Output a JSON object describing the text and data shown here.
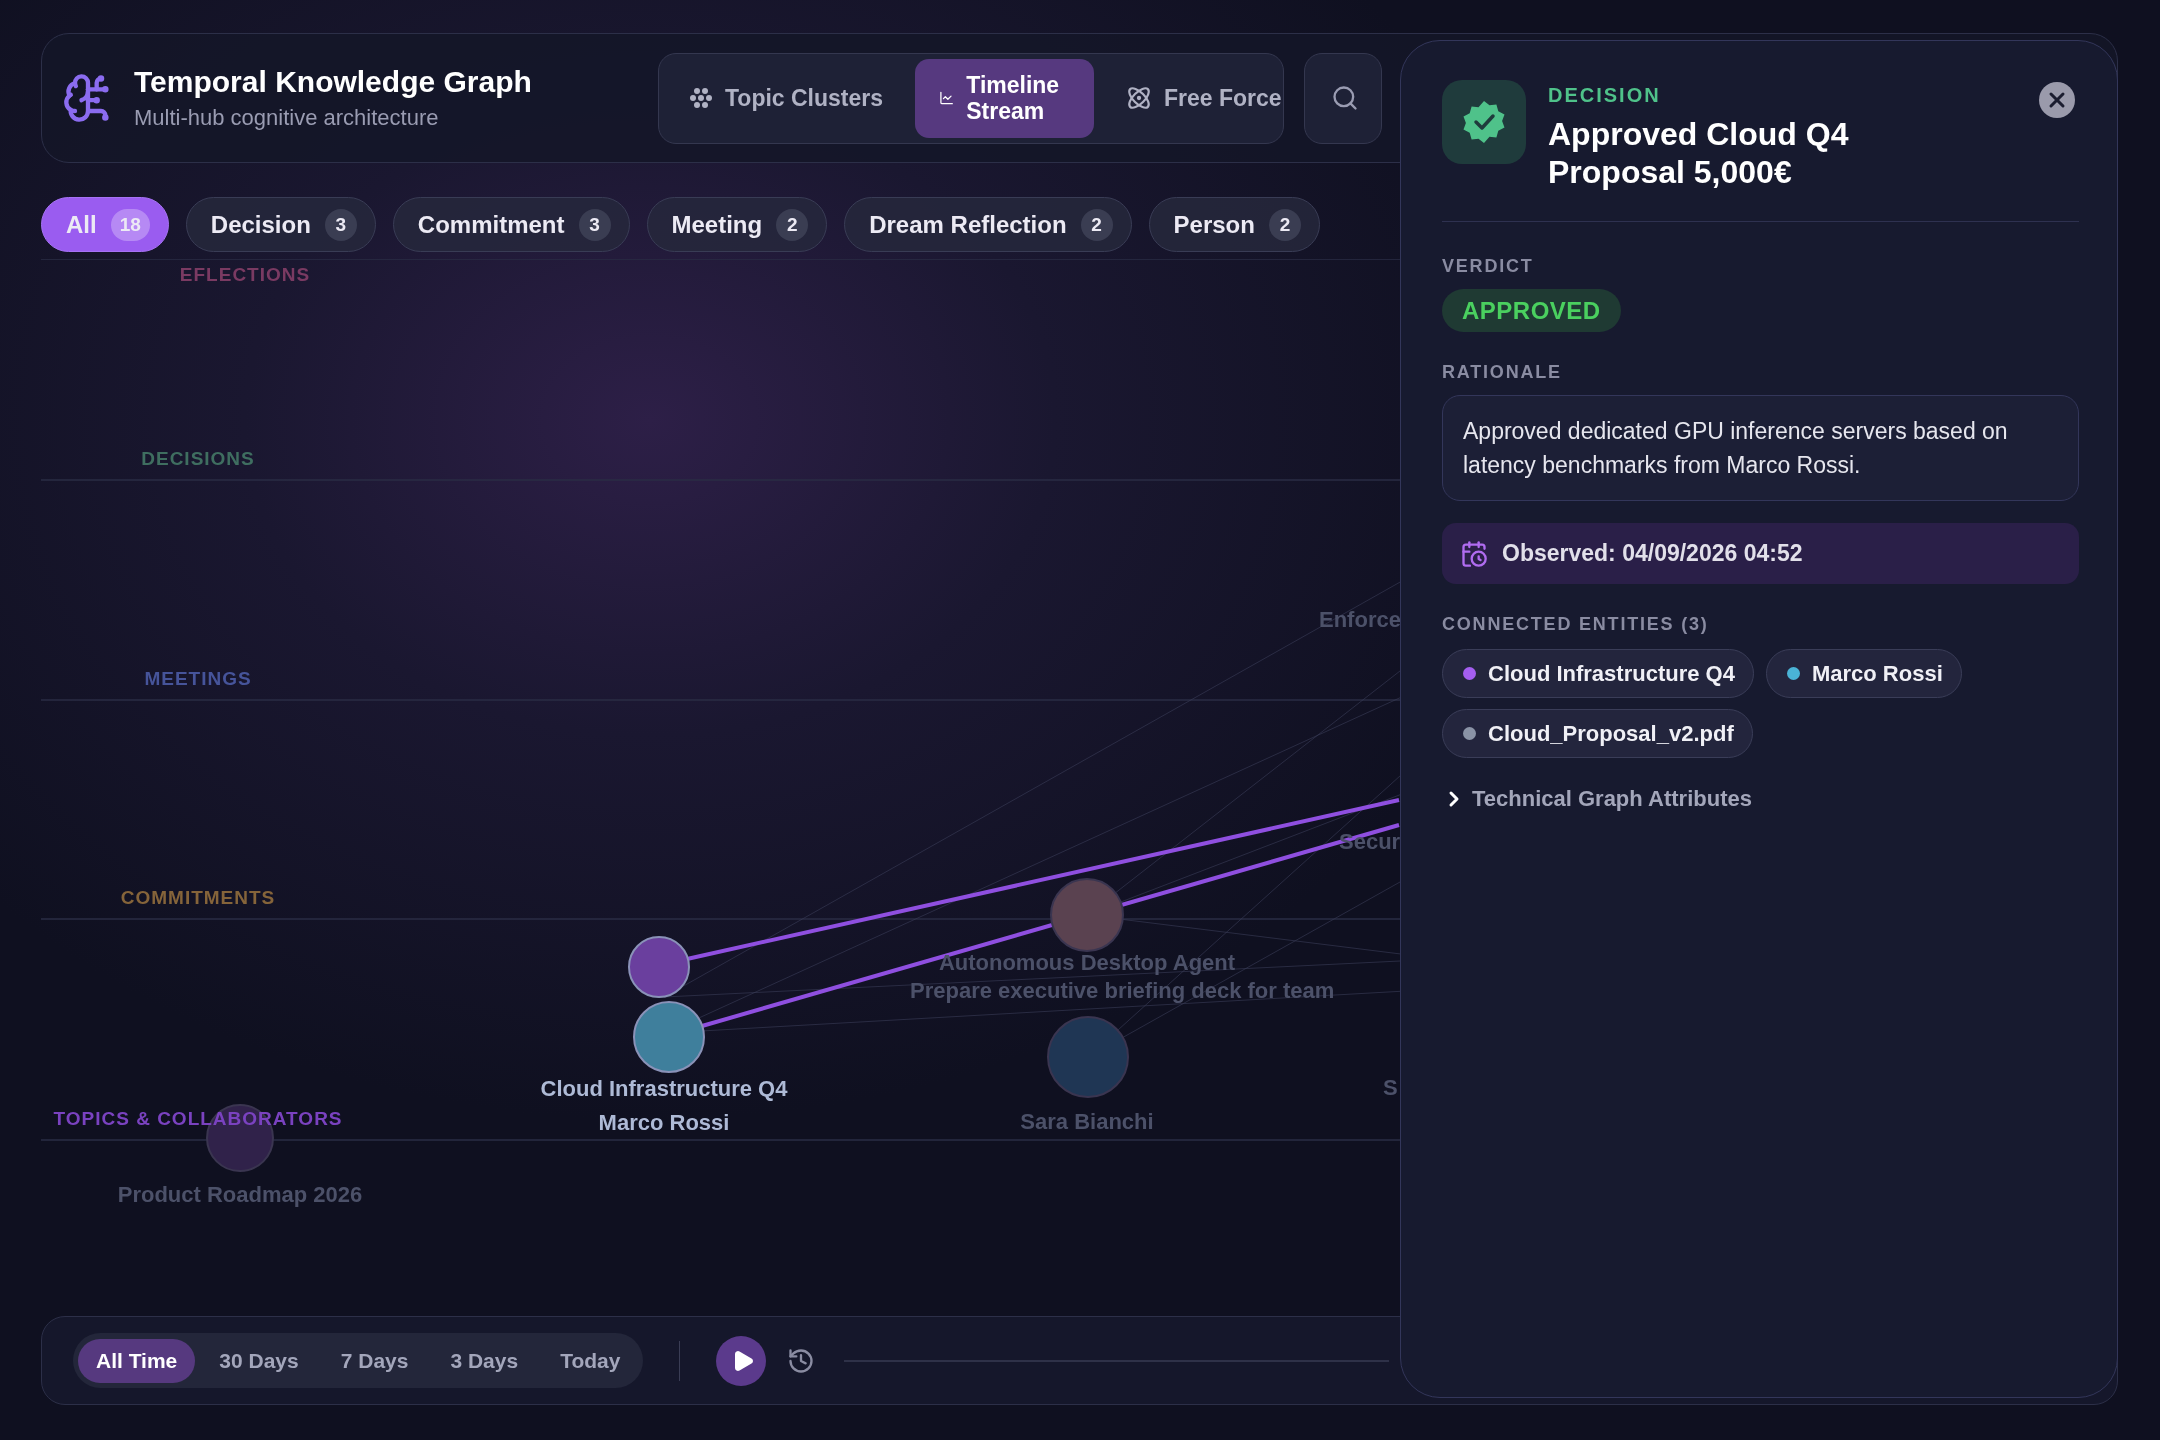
{
  "app": {
    "title": "Temporal Knowledge Graph",
    "subtitle": "Multi-hub cognitive architecture"
  },
  "view_modes": [
    {
      "kind": "clusters",
      "label": "Topic Clusters",
      "selected": false
    },
    {
      "kind": "timeline",
      "label": "Timeline Stream",
      "selected": true
    },
    {
      "kind": "force",
      "label": "Free Force",
      "selected": false
    }
  ],
  "filters": [
    {
      "label": "All",
      "count": "18",
      "selected": true
    },
    {
      "label": "Decision",
      "count": "3",
      "selected": false
    },
    {
      "label": "Commitment",
      "count": "3",
      "selected": false
    },
    {
      "label": "Meeting",
      "count": "2",
      "selected": false
    },
    {
      "label": "Dream Reflection",
      "count": "2",
      "selected": false
    },
    {
      "label": "Person",
      "count": "2",
      "selected": false
    }
  ],
  "lanes": [
    {
      "label": "EFLECTIONS",
      "color": "#7a3a62"
    },
    {
      "label": "DECISIONS",
      "color": "#3f6e60"
    },
    {
      "label": "MEETINGS",
      "color": "#46549a"
    },
    {
      "label": "COMMITMENTS",
      "color": "#85643a"
    },
    {
      "label": "TOPICS & COLLABORATORS",
      "color": "#7a42c0"
    }
  ],
  "graph": {
    "nodes": [
      {
        "label": "Cloud Infrastructure Q4",
        "color": "#6a3f9e",
        "highlighted": true
      },
      {
        "label": "Marco Rossi",
        "color": "#3f7f9c",
        "highlighted": true
      },
      {
        "label": "Autonomous Desktop Agent",
        "color": "#5a4250",
        "highlighted": false
      },
      {
        "label": "Sara Bianchi",
        "color": "#1f3654",
        "highlighted": false
      },
      {
        "label": "Product Roadmap 2026",
        "color": "#30224a",
        "highlighted": false
      }
    ],
    "other_labels": [
      "Prepare executive briefing deck for team",
      "Enforce",
      "Secur",
      "S"
    ]
  },
  "timeline": {
    "ranges": [
      {
        "label": "All Time",
        "selected": true
      },
      {
        "label": "30 Days",
        "selected": false
      },
      {
        "label": "7 Days",
        "selected": false
      },
      {
        "label": "3 Days",
        "selected": false
      },
      {
        "label": "Today",
        "selected": false
      }
    ],
    "playing": false
  },
  "detail": {
    "type": "DECISION",
    "title": "Approved Cloud Q4 Proposal 5,000€",
    "verdict_label": "VERDICT",
    "verdict": "APPROVED",
    "rationale_label": "RATIONALE",
    "rationale": "Approved dedicated GPU inference servers based on latency benchmarks from Marco Rossi.",
    "observed": "Observed: 04/09/2026 04:52",
    "connected_label": "CONNECTED ENTITIES (3)",
    "entities": [
      {
        "name": "Cloud Infrastructure Q4",
        "color": "#a45ef0"
      },
      {
        "name": "Marco Rossi",
        "color": "#4ab3d6"
      },
      {
        "name": "Cloud_Proposal_v2.pdf",
        "color": "#8a93a6"
      }
    ],
    "attributes": {
      "label": "Technical Graph Attributes",
      "expanded": false
    }
  }
}
